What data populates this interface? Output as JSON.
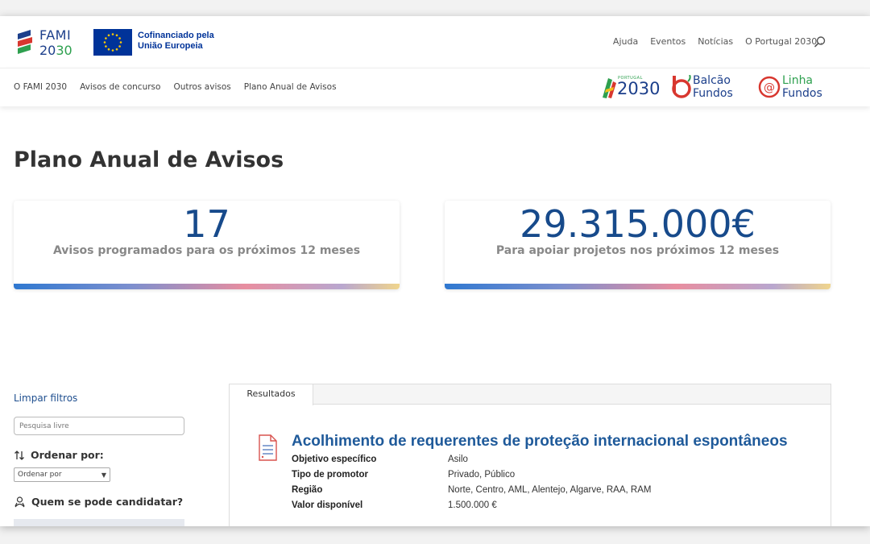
{
  "header": {
    "brand": {
      "word": "FAMI",
      "year_prefix": "20",
      "year_suffix": "30"
    },
    "eu": {
      "line1": "Cofinanciado pela",
      "line2": "União Europeia"
    },
    "top_nav": [
      "Ajuda",
      "Eventos",
      "Notícias",
      "O Portugal 2030"
    ],
    "sub_nav": [
      "O FAMI 2030",
      "Avisos de concurso",
      "Outros avisos",
      "Plano Anual de Avisos"
    ],
    "partners": {
      "portugal2030": {
        "small": "PORTUGAL",
        "big": "2030"
      },
      "balcao": {
        "line1": "Balcão",
        "line2": "Fundos"
      },
      "linha": {
        "line1": "Linha",
        "line2": "Fundos"
      }
    }
  },
  "page": {
    "title": "Plano Anual de Avisos"
  },
  "stats": [
    {
      "value": "17",
      "label": "Avisos programados para os próximos 12 meses"
    },
    {
      "value": "29.315.000€",
      "label": "Para apoiar projetos nos próximos 12 meses"
    }
  ],
  "filters": {
    "clear_label": "Limpar filtros",
    "search_placeholder": "Pesquisa livre",
    "sort_title": "Ordenar por:",
    "sort_select_value": "Ordenar por",
    "who_title": "Quem se pode candidatar?"
  },
  "results": {
    "tab_label": "Resultados",
    "items": [
      {
        "title": "Acolhimento de requerentes de proteção internacional espontâneos",
        "fields": [
          {
            "key": "Objetivo específico",
            "value": "Asilo"
          },
          {
            "key": "Tipo de promotor",
            "value": "Privado, Público"
          },
          {
            "key": "Região",
            "value": "Norte, Centro, AML, Alentejo, Algarve, RAA, RAM"
          },
          {
            "key": "Valor disponível",
            "value": "1.500.000 €"
          }
        ]
      }
    ]
  },
  "colors": {
    "brand_blue": "#1c3f8b",
    "accent_green": "#2ea04f",
    "link_blue": "#1f4f8f",
    "eu_blue": "#003399"
  }
}
